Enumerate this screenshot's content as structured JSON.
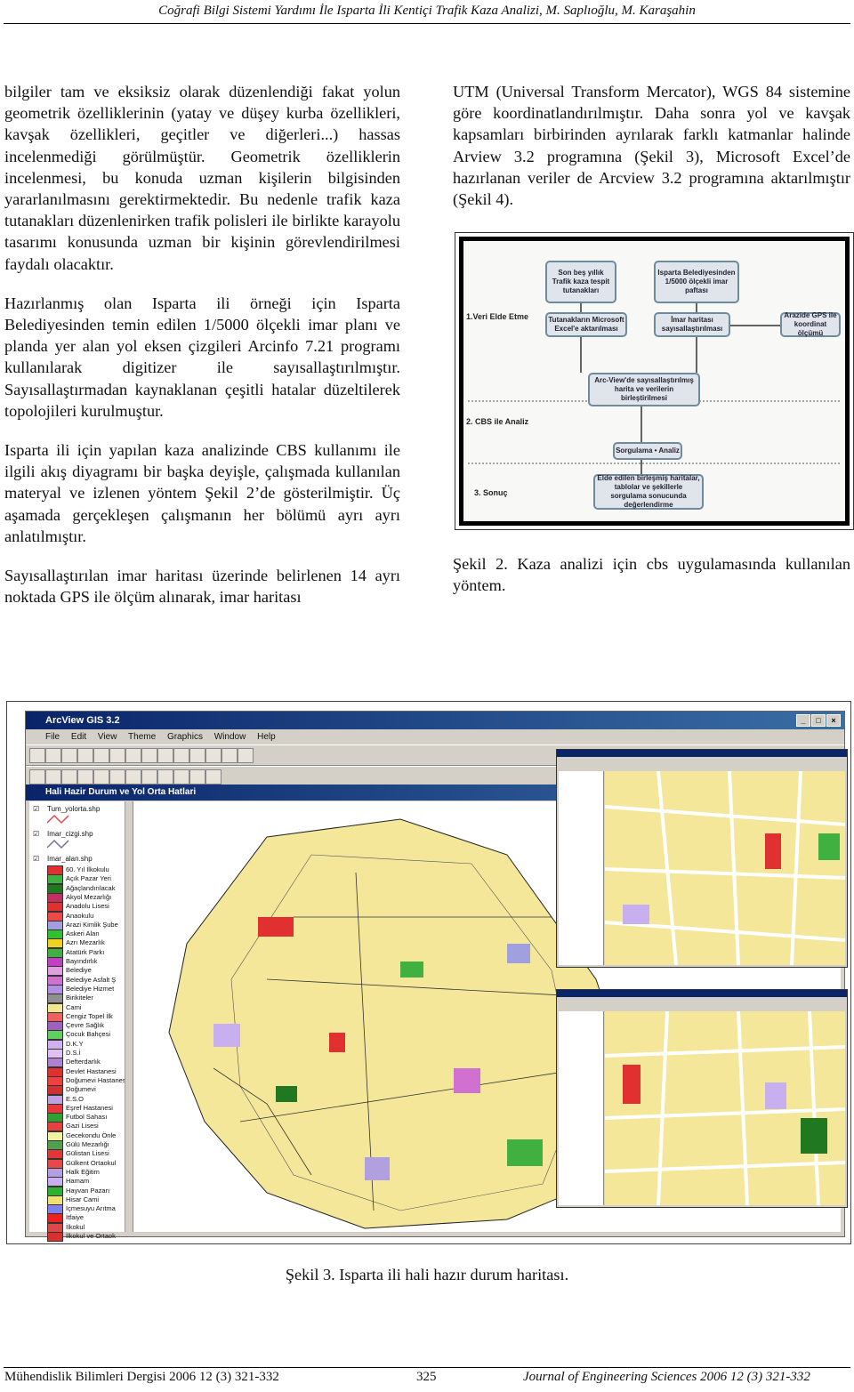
{
  "header": {
    "running_title": "Coğrafi Bilgi Sistemi Yardımı İle Isparta İli Kentiçi Trafik Kaza Analizi, M. Saplıoğlu, M. Karaşahin"
  },
  "left_column": {
    "paragraphs": [
      "bilgiler tam ve eksiksiz olarak düzenlendiği fakat yolun geometrik özelliklerinin (yatay ve düşey kurba özellikleri, kavşak özellikleri, geçitler ve diğerleri...) hassas incelenmediği görülmüştür. Geometrik özelliklerin incelenmesi, bu konuda uzman kişilerin bilgisinden yararlanılmasını gerektirmektedir. Bu nedenle trafik kaza tutanakları düzenlenirken trafik polisleri ile birlikte karayolu tasarımı konusunda uzman bir kişinin görevlendirilmesi faydalı olacaktır.",
      "Hazırlanmış olan Isparta ili örneği için Isparta Belediyesinden temin edilen 1/5000 ölçekli imar planı ve planda yer alan yol eksen çizgileri Arcinfo 7.21 programı kullanılarak digitizer ile sayısallaştırılmıştır. Sayısallaştırmadan kaynaklanan çeşitli hatalar düzeltilerek topolojileri kurulmuştur.",
      "Isparta ili için yapılan kaza analizinde CBS kullanımı ile ilgili akış diyagramı bir başka deyişle, çalışmada kullanılan materyal ve izlenen yöntem Şekil 2’de gösterilmiştir. Üç aşamada gerçekleşen çalışmanın her bölümü ayrı ayrı anlatılmıştır.",
      "Sayısallaştırılan imar haritası üzerinde belirlenen 14 ayrı noktada GPS ile ölçüm alınarak, imar haritası"
    ]
  },
  "right_column": {
    "paragraphs": [
      "UTM (Universal Transform Mercator), WGS 84 sistemine göre koordinatlandırılmıştır. Daha sonra yol ve kavşak kapsamları birbirinden ayrılarak farklı katmanlar halinde Arview 3.2 programına (Şekil 3), Microsoft Excel’de hazırlanan veriler de Arcview 3.2 programına aktarılmıştır (Şekil 4)."
    ]
  },
  "figure2": {
    "stages": [
      "1.Veri Elde Etme",
      "2. CBS ile Analiz",
      "3. Sonuç"
    ],
    "boxes": [
      "Son beş yıllık Trafik kaza tespit tutanakları",
      "Isparta Belediyesinden 1/5000 ölçekli imar paftası",
      "Tutanakların Microsoft Excel'e aktarılması",
      "İmar haritası sayısallaştırılması",
      "Arazide GPS ile koordinat ölçümü",
      "Arc-View'de sayısallaştırılmış harita ve verilerin birleştirilmesi",
      "Sorgulama • Analiz",
      "Elde edilen birleşmiş haritalar, tablolar ve şekillerle sorgulama sonucunda değerlendirme"
    ],
    "caption": "Şekil 2. Kaza analizi için cbs uygulamasında kullanılan yöntem."
  },
  "figure3": {
    "window_title": "ArcView GIS 3.2",
    "menu": [
      "File",
      "Edit",
      "View",
      "Theme",
      "Graphics",
      "Window",
      "Help"
    ],
    "view_title": "Hali Hazir Durum ve Yol Orta Hatlari",
    "themes": [
      "Tum_yolorta.shp",
      "Imar_cizgi.shp",
      "Imar_alan.shp"
    ],
    "legend_items": [
      {
        "label": "60. Yıl İlkokulu",
        "color": "#e03030"
      },
      {
        "label": "Açık Pazar Yeri",
        "color": "#40b040"
      },
      {
        "label": "Ağaçlandırılacak",
        "color": "#207820"
      },
      {
        "label": "Akyol Mezarlığı",
        "color": "#c03060"
      },
      {
        "label": "Anadolu Lisesi",
        "color": "#e03030"
      },
      {
        "label": "Anaokulu",
        "color": "#f04848"
      },
      {
        "label": "Arazi Kimlik Şube",
        "color": "#a0a0e0"
      },
      {
        "label": "Askeri Alan",
        "color": "#30c030"
      },
      {
        "label": "Azrı Mezarlık",
        "color": "#f0d020"
      },
      {
        "label": "Atatürk Parkı",
        "color": "#40b040"
      },
      {
        "label": "Bayındırlık",
        "color": "#c040c0"
      },
      {
        "label": "Belediye",
        "color": "#e0a0e0"
      },
      {
        "label": "Belediye Asfalt Ş",
        "color": "#d070d0"
      },
      {
        "label": "Belediye Hizmet",
        "color": "#b090e0"
      },
      {
        "label": "Birikiteler",
        "color": "#909090"
      },
      {
        "label": "Cami",
        "color": "#f0e890"
      },
      {
        "label": "Cengiz Topel İlk",
        "color": "#f06060"
      },
      {
        "label": "Çevre Sağlık",
        "color": "#a060c0"
      },
      {
        "label": "Çocuk Bahçesi",
        "color": "#60d060"
      },
      {
        "label": "D.K.Y",
        "color": "#d0b0f0"
      },
      {
        "label": "D.S.İ",
        "color": "#e0c0f0"
      },
      {
        "label": "Defterdarlık",
        "color": "#b080d0"
      },
      {
        "label": "Devlet Hastanesi",
        "color": "#e03030"
      },
      {
        "label": "Doğumevi Hastanesi",
        "color": "#f04040"
      },
      {
        "label": "Doğumevi",
        "color": "#d03030"
      },
      {
        "label": "E.S.O",
        "color": "#c0a0e0"
      },
      {
        "label": "Eşref Hastanesi",
        "color": "#e83838"
      },
      {
        "label": "Futbol Sahası",
        "color": "#30a030"
      },
      {
        "label": "Gazi Lisesi",
        "color": "#e84040"
      },
      {
        "label": "Gecekondu Önle",
        "color": "#f0f0a0"
      },
      {
        "label": "Gülü Mezarlığı",
        "color": "#50a050"
      },
      {
        "label": "Gülistan Lisesi",
        "color": "#e03838"
      },
      {
        "label": "Gülkent Ortaokul",
        "color": "#e84848"
      },
      {
        "label": "Halk Eğitim",
        "color": "#b0a0e0"
      },
      {
        "label": "Hamam",
        "color": "#c8b0f0"
      },
      {
        "label": "Hayvan Pazarı",
        "color": "#30b030"
      },
      {
        "label": "Hisar Cami",
        "color": "#f0e070"
      },
      {
        "label": "İçmesuyu Arıtma",
        "color": "#8080f0"
      },
      {
        "label": "İtfaiye",
        "color": "#f02020"
      },
      {
        "label": "İlkokul",
        "color": "#e04848"
      },
      {
        "label": "İlkokul ve Ortaok",
        "color": "#d83030"
      }
    ],
    "caption": "Şekil 3. Isparta ili hali hazır durum haritası."
  },
  "footer": {
    "left": "Mühendislik Bilimleri Dergisi  2006 12 (3) 321-332",
    "page": "325",
    "right": "Journal of Engineering Sciences 2006 12 (3) 321-332"
  }
}
